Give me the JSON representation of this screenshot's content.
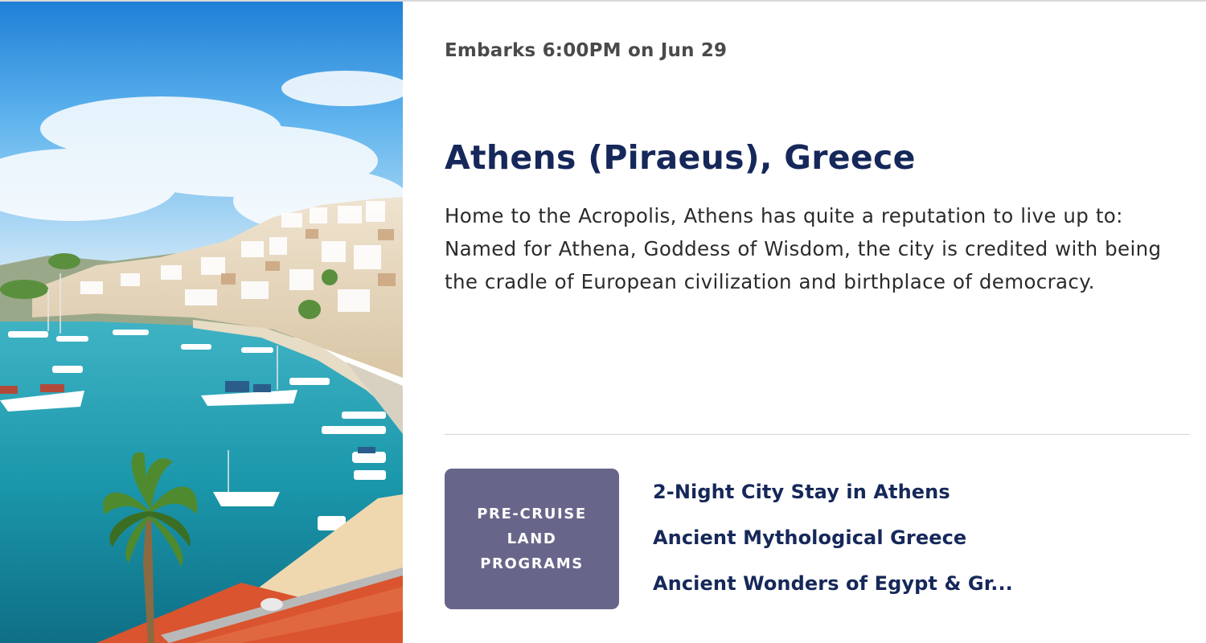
{
  "embark": {
    "text": "Embarks 6:00PM on Jun 29"
  },
  "port": {
    "title": "Athens (Piraeus), Greece",
    "description": "Home to the Acropolis, Athens has quite a reputation to live up to: Named for Athena, Goddess of Wisdom, the city is credited with being the cradle of European civilization and birthplace of democracy."
  },
  "land_programs": {
    "badge_lines": [
      "PRE-CRUISE",
      "LAND",
      "PROGRAMS"
    ],
    "items": [
      "2-Night City Stay in Athens",
      "Ancient Mythological Greece",
      "Ancient Wonders of Egypt & Gr..."
    ]
  },
  "colors": {
    "title_navy": "#16285a",
    "badge_purple": "#67668a",
    "sea": "#1f9ab0",
    "sky": "#3f9fe4"
  },
  "hero_image": {
    "icon": "harbor-photo"
  }
}
